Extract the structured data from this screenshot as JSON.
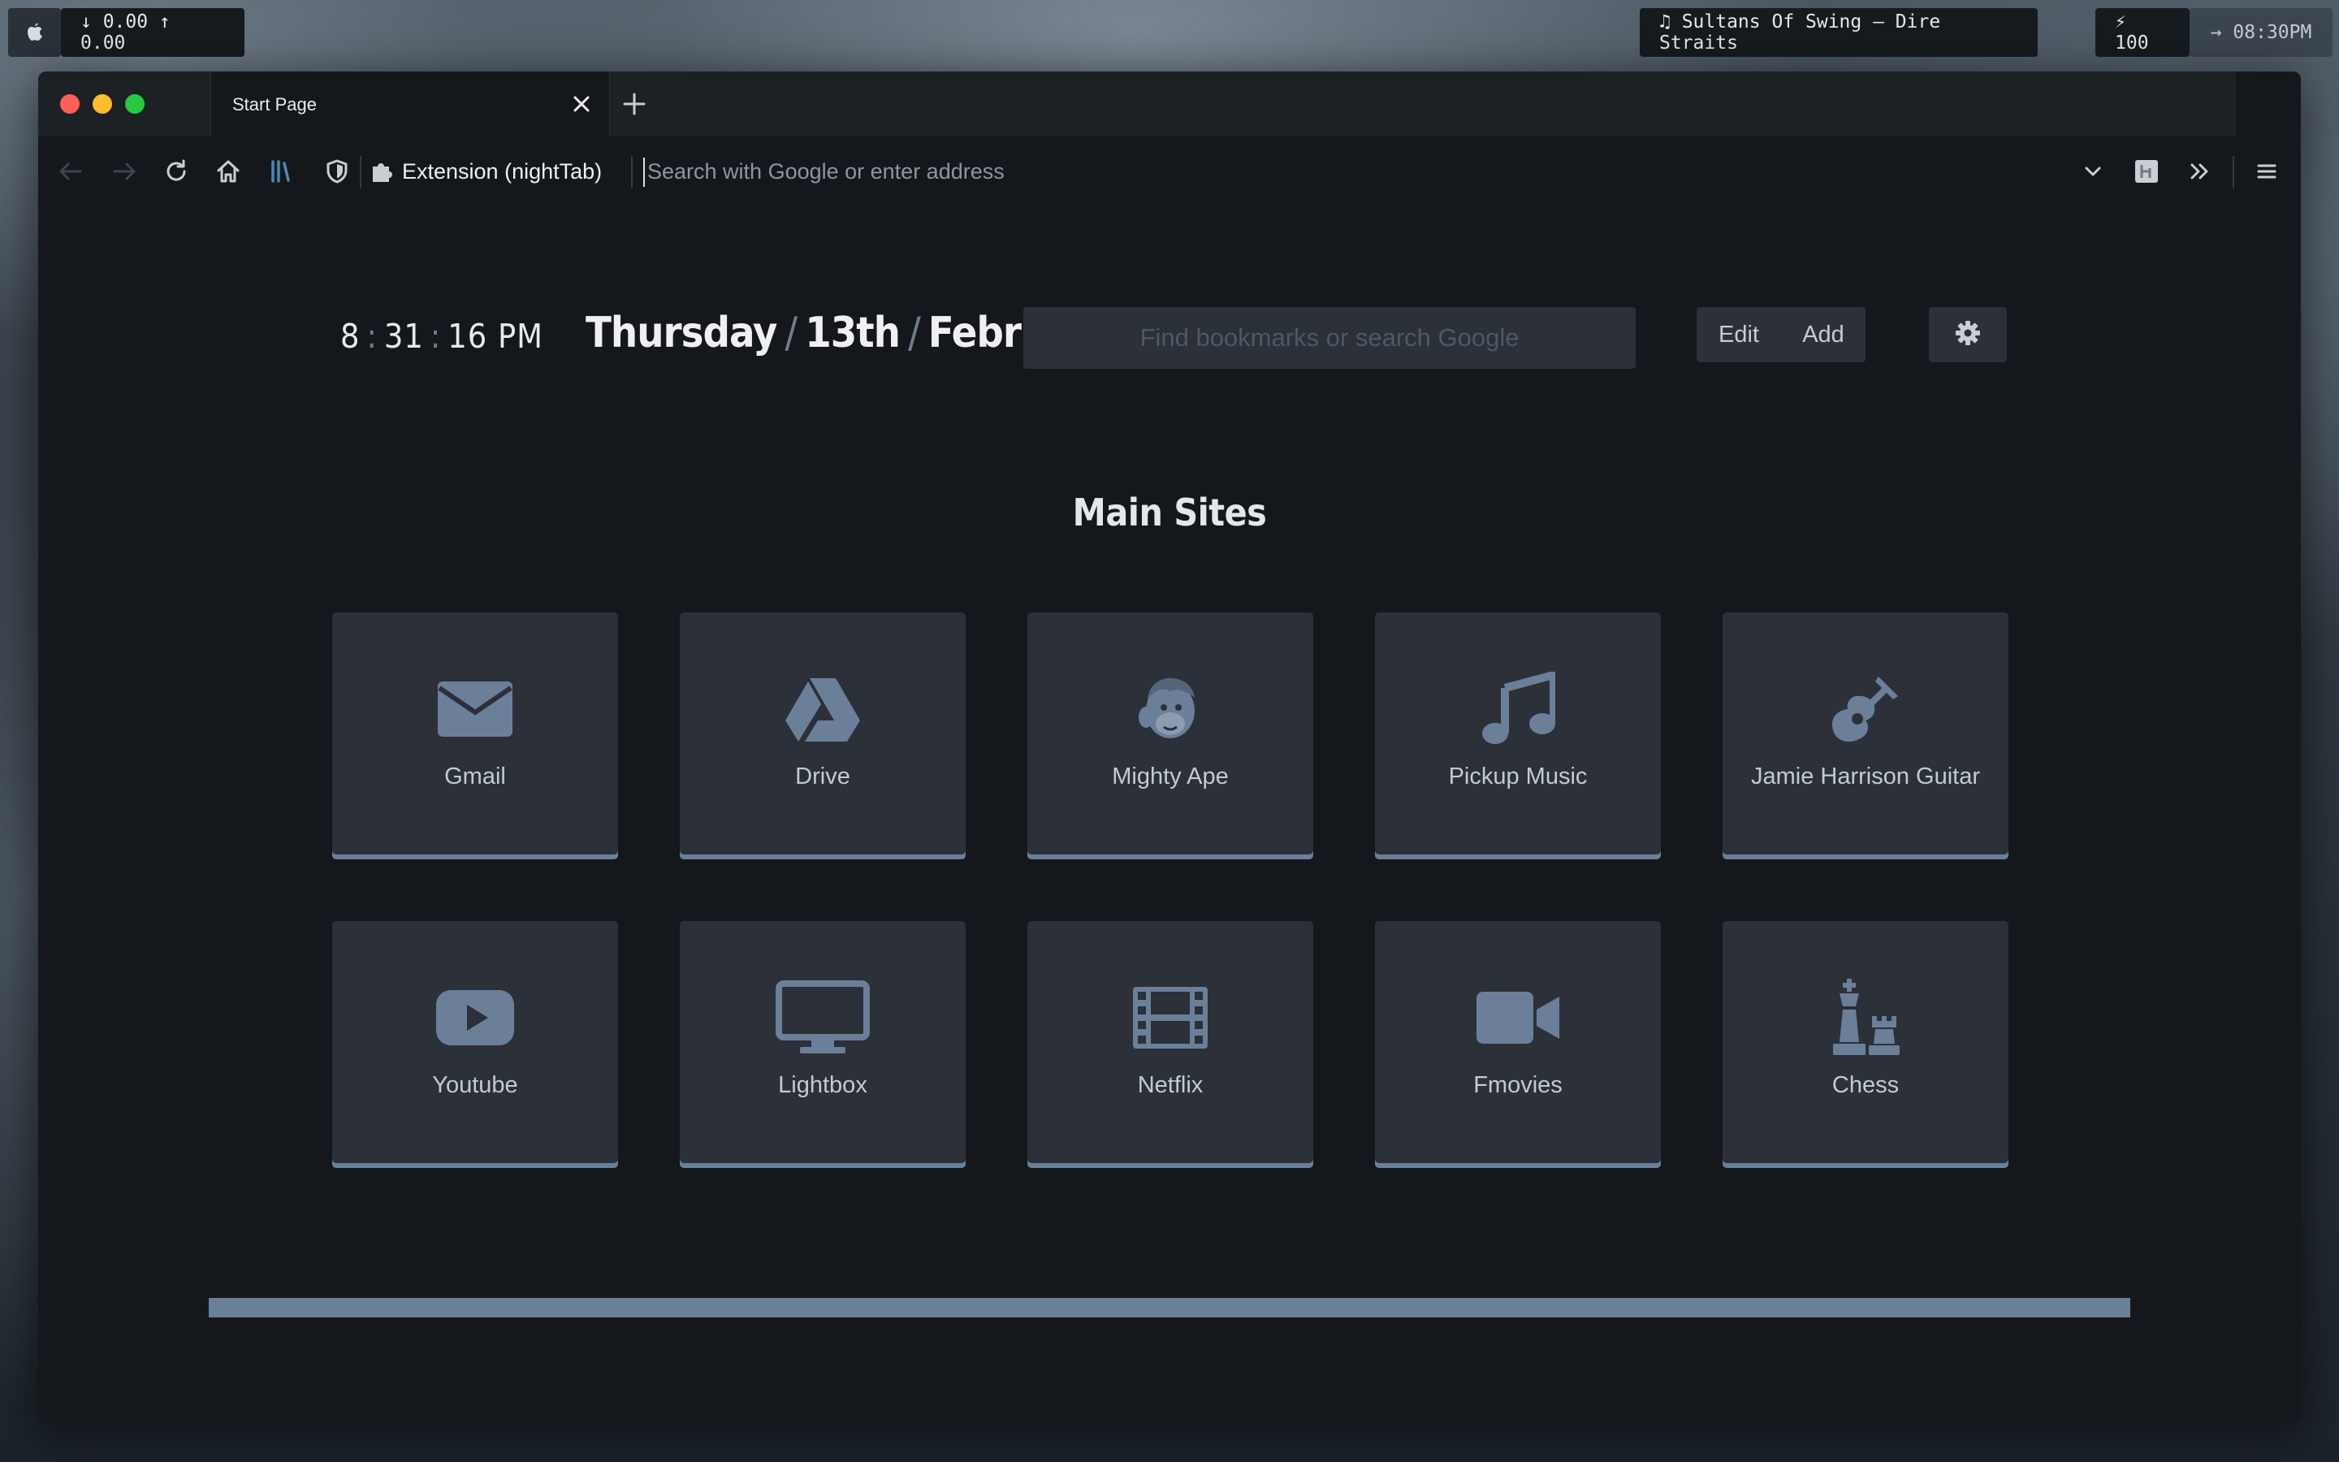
{
  "menubar": {
    "apple_icon": "apple-icon",
    "network": "↓ 0.00 ↑ 0.00",
    "now_playing": "♫ Sultans Of Swing – Dire Straits",
    "battery": "⚡ 100",
    "clock": "→ 08:30PM"
  },
  "browser": {
    "tab_title": "Start Page",
    "extension_label": "Extension (nightTab)",
    "address_placeholder": "Search with Google or enter address"
  },
  "page": {
    "time": {
      "hour": "8",
      "minute": "31",
      "second": "16",
      "ampm": "PM"
    },
    "date": {
      "day": "Thursday",
      "date": "13th",
      "month": "February"
    },
    "search_placeholder": "Find bookmarks or search Google",
    "edit_label": "Edit",
    "add_label": "Add",
    "section_title": "Main Sites",
    "bookmarks": [
      {
        "label": "Gmail",
        "icon": "envelope-icon"
      },
      {
        "label": "Drive",
        "icon": "google-drive-icon"
      },
      {
        "label": "Mighty Ape",
        "icon": "mailchimp-icon"
      },
      {
        "label": "Pickup Music",
        "icon": "music-note-icon"
      },
      {
        "label": "Jamie Harrison Guitar",
        "icon": "guitar-icon"
      },
      {
        "label": "Youtube",
        "icon": "youtube-icon"
      },
      {
        "label": "Lightbox",
        "icon": "desktop-icon"
      },
      {
        "label": "Netflix",
        "icon": "film-icon"
      },
      {
        "label": "Fmovies",
        "icon": "video-camera-icon"
      },
      {
        "label": "Chess",
        "icon": "chess-icon"
      }
    ],
    "accent_color": "#6b7f99"
  }
}
